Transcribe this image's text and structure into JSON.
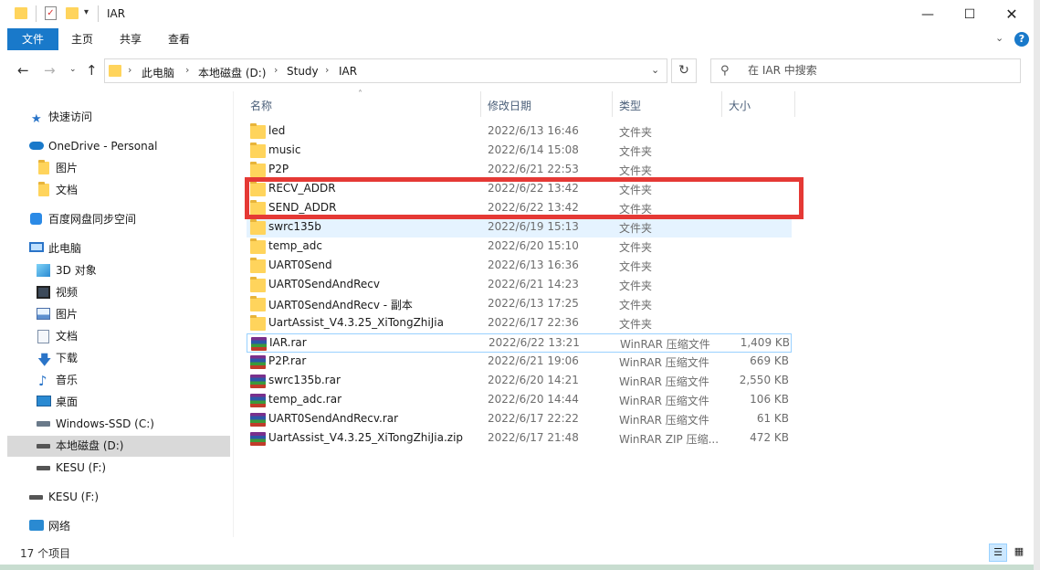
{
  "window": {
    "title": "IAR"
  },
  "ribbon": {
    "tabs": [
      "文件",
      "主页",
      "共享",
      "查看"
    ]
  },
  "nav": {
    "path": [
      "此电脑",
      "本地磁盘 (D:)",
      "Study",
      "IAR"
    ],
    "search_placeholder": "在 IAR 中搜索"
  },
  "sidebar": {
    "items": [
      {
        "label": "快速访问",
        "icon": "star-icon"
      },
      {
        "label": "OneDrive - Personal",
        "icon": "cloud-icon"
      },
      {
        "label": "图片",
        "icon": "folder-icon"
      },
      {
        "label": "文档",
        "icon": "folder-icon"
      },
      {
        "label": "百度网盘同步空间",
        "icon": "baidu-netdisk-icon"
      },
      {
        "label": "此电脑",
        "icon": "computer-icon"
      },
      {
        "label": "3D 对象",
        "icon": "cube-3d-icon"
      },
      {
        "label": "视频",
        "icon": "video-icon"
      },
      {
        "label": "图片",
        "icon": "pictures-icon"
      },
      {
        "label": "文档",
        "icon": "documents-icon"
      },
      {
        "label": "下载",
        "icon": "download-icon"
      },
      {
        "label": "音乐",
        "icon": "music-icon"
      },
      {
        "label": "桌面",
        "icon": "desktop-icon"
      },
      {
        "label": "Windows-SSD (C:)",
        "icon": "drive-icon"
      },
      {
        "label": "本地磁盘 (D:)",
        "icon": "drive-icon"
      },
      {
        "label": "KESU (F:)",
        "icon": "usb-drive-icon"
      },
      {
        "label": "KESU (F:)",
        "icon": "usb-drive-icon"
      },
      {
        "label": "网络",
        "icon": "network-icon"
      }
    ]
  },
  "columns": {
    "name": "名称",
    "date": "修改日期",
    "type": "类型",
    "size": "大小"
  },
  "files": [
    {
      "name": "led",
      "date": "2022/6/13 16:46",
      "type": "文件夹",
      "size": "",
      "icon": "folder-icon"
    },
    {
      "name": "music",
      "date": "2022/6/14 15:08",
      "type": "文件夹",
      "size": "",
      "icon": "folder-icon"
    },
    {
      "name": "P2P",
      "date": "2022/6/21 22:53",
      "type": "文件夹",
      "size": "",
      "icon": "folder-icon"
    },
    {
      "name": "RECV_ADDR",
      "date": "2022/6/22 13:42",
      "type": "文件夹",
      "size": "",
      "icon": "folder-icon"
    },
    {
      "name": "SEND_ADDR",
      "date": "2022/6/22 13:42",
      "type": "文件夹",
      "size": "",
      "icon": "folder-icon"
    },
    {
      "name": "swrc135b",
      "date": "2022/6/19 15:13",
      "type": "文件夹",
      "size": "",
      "icon": "folder-icon"
    },
    {
      "name": "temp_adc",
      "date": "2022/6/20 15:10",
      "type": "文件夹",
      "size": "",
      "icon": "folder-icon"
    },
    {
      "name": "UART0Send",
      "date": "2022/6/13 16:36",
      "type": "文件夹",
      "size": "",
      "icon": "folder-icon"
    },
    {
      "name": "UART0SendAndRecv",
      "date": "2022/6/21 14:23",
      "type": "文件夹",
      "size": "",
      "icon": "folder-icon"
    },
    {
      "name": "UART0SendAndRecv - 副本",
      "date": "2022/6/13 17:25",
      "type": "文件夹",
      "size": "",
      "icon": "folder-icon"
    },
    {
      "name": "UartAssist_V4.3.25_XiTongZhiJia",
      "date": "2022/6/17 22:36",
      "type": "文件夹",
      "size": "",
      "icon": "folder-icon"
    },
    {
      "name": "IAR.rar",
      "date": "2022/6/22 13:21",
      "type": "WinRAR 压缩文件",
      "size": "1,409 KB",
      "icon": "winrar-archive-icon"
    },
    {
      "name": "P2P.rar",
      "date": "2022/6/21 19:06",
      "type": "WinRAR 压缩文件",
      "size": "669 KB",
      "icon": "winrar-archive-icon"
    },
    {
      "name": "swrc135b.rar",
      "date": "2022/6/20 14:21",
      "type": "WinRAR 压缩文件",
      "size": "2,550 KB",
      "icon": "winrar-archive-icon"
    },
    {
      "name": "temp_adc.rar",
      "date": "2022/6/20 14:44",
      "type": "WinRAR 压缩文件",
      "size": "106 KB",
      "icon": "winrar-archive-icon"
    },
    {
      "name": "UART0SendAndRecv.rar",
      "date": "2022/6/17 22:22",
      "type": "WinRAR 压缩文件",
      "size": "61 KB",
      "icon": "winrar-archive-icon"
    },
    {
      "name": "UartAssist_V4.3.25_XiTongZhiJia.zip",
      "date": "2022/6/17 21:48",
      "type": "WinRAR ZIP 压缩...",
      "size": "472 KB",
      "icon": "winrar-archive-icon"
    }
  ],
  "status": {
    "item_count": "17 个项目"
  },
  "colors": {
    "accent": "#1979ca",
    "highlight_box": "#e53935",
    "folder": "#ffd45c",
    "selected": "#d9d9d9"
  }
}
